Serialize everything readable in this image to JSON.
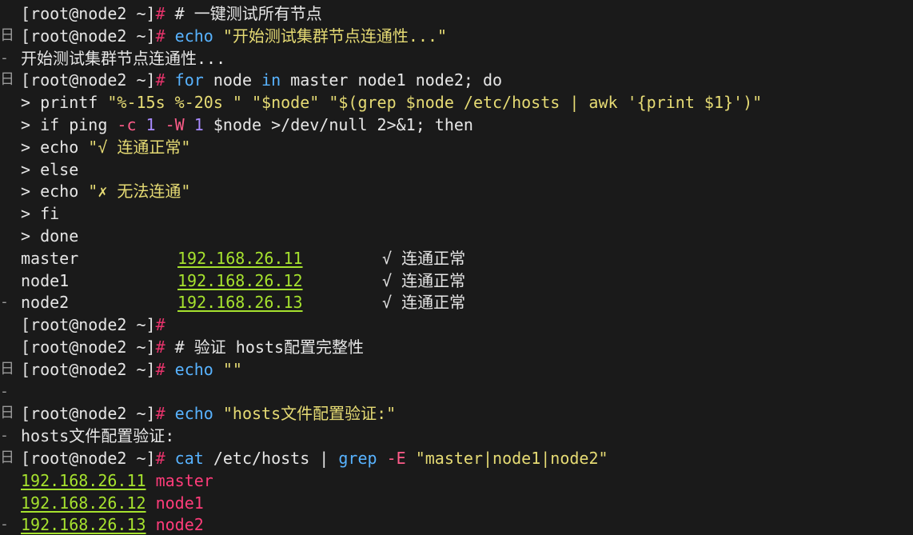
{
  "terminal": {
    "prompt": "[root@node2 ~]",
    "hash": "#",
    "lines": [
      {
        "gutter": "",
        "segments": [
          {
            "t": "prompt"
          },
          {
            "t": "text",
            "v": " # 一键测试所有节点",
            "c": "comment"
          }
        ]
      },
      {
        "gutter": "日",
        "segments": [
          {
            "t": "prompt"
          },
          {
            "t": "text",
            "v": " echo",
            "c": "kw"
          },
          {
            "t": "text",
            "v": " \"开始测试集群节点连通性...\"",
            "c": "str"
          }
        ]
      },
      {
        "gutter": "-",
        "segments": [
          {
            "t": "text",
            "v": "开始测试集群节点连通性...",
            "c": "var"
          }
        ]
      },
      {
        "gutter": "日",
        "segments": [
          {
            "t": "prompt"
          },
          {
            "t": "text",
            "v": " for",
            "c": "kw"
          },
          {
            "t": "text",
            "v": " node ",
            "c": "var"
          },
          {
            "t": "text",
            "v": "in",
            "c": "kw"
          },
          {
            "t": "text",
            "v": " master node1 node2; ",
            "c": "var"
          },
          {
            "t": "text",
            "v": "do",
            "c": "var"
          }
        ]
      },
      {
        "gutter": "",
        "segments": [
          {
            "t": "text",
            "v": "> printf ",
            "c": "var"
          },
          {
            "t": "text",
            "v": "\"%-15s %-20s \"",
            "c": "str"
          },
          {
            "t": "text",
            "v": " \"$node\" \"$(grep $node /etc/hosts | awk '{print $1}')\"",
            "c": "str"
          }
        ]
      },
      {
        "gutter": "",
        "segments": [
          {
            "t": "text",
            "v": "> if ping ",
            "c": "var"
          },
          {
            "t": "text",
            "v": "-c",
            "c": "opt"
          },
          {
            "t": "text",
            "v": " 1 ",
            "c": "num"
          },
          {
            "t": "text",
            "v": "-W",
            "c": "opt"
          },
          {
            "t": "text",
            "v": " 1 ",
            "c": "num"
          },
          {
            "t": "text",
            "v": "$node >/dev/null 2>&1; then",
            "c": "var"
          }
        ]
      },
      {
        "gutter": "",
        "segments": [
          {
            "t": "text",
            "v": "> echo ",
            "c": "var"
          },
          {
            "t": "text",
            "v": "\"√ 连通正常\"",
            "c": "str"
          }
        ]
      },
      {
        "gutter": "",
        "segments": [
          {
            "t": "text",
            "v": "> else",
            "c": "var"
          }
        ]
      },
      {
        "gutter": "",
        "segments": [
          {
            "t": "text",
            "v": "> echo ",
            "c": "var"
          },
          {
            "t": "text",
            "v": "\"✗ 无法连通\"",
            "c": "str"
          }
        ]
      },
      {
        "gutter": "",
        "segments": [
          {
            "t": "text",
            "v": "> fi",
            "c": "var"
          }
        ]
      },
      {
        "gutter": "",
        "segments": [
          {
            "t": "text",
            "v": "> done",
            "c": "var"
          }
        ]
      }
    ],
    "results": [
      {
        "gutter": "",
        "node": "master",
        "ip": "192.168.26.11",
        "status": "√ 连通正常"
      },
      {
        "gutter": "",
        "node": "node1",
        "ip": "192.168.26.12",
        "status": "√ 连通正常"
      },
      {
        "gutter": "-",
        "node": "node2",
        "ip": "192.168.26.13",
        "status": "√ 连通正常"
      }
    ],
    "lines2": [
      {
        "gutter": "",
        "segments": [
          {
            "t": "prompt"
          }
        ]
      },
      {
        "gutter": "",
        "segments": [
          {
            "t": "prompt"
          },
          {
            "t": "text",
            "v": " # 验证 hosts配置完整性",
            "c": "comment"
          }
        ]
      },
      {
        "gutter": "日",
        "segments": [
          {
            "t": "prompt"
          },
          {
            "t": "text",
            "v": " echo",
            "c": "kw"
          },
          {
            "t": "text",
            "v": " \"\"",
            "c": "str"
          }
        ]
      },
      {
        "gutter": "-",
        "segments": []
      },
      {
        "gutter": "日",
        "segments": [
          {
            "t": "prompt"
          },
          {
            "t": "text",
            "v": " echo",
            "c": "kw"
          },
          {
            "t": "text",
            "v": " \"hosts文件配置验证:\"",
            "c": "str"
          }
        ]
      },
      {
        "gutter": "-",
        "segments": [
          {
            "t": "text",
            "v": "hosts文件配置验证:",
            "c": "var"
          }
        ]
      },
      {
        "gutter": "日",
        "segments": [
          {
            "t": "prompt"
          },
          {
            "t": "text",
            "v": " cat",
            "c": "kw"
          },
          {
            "t": "text",
            "v": " /etc/hosts | ",
            "c": "var"
          },
          {
            "t": "text",
            "v": "grep",
            "c": "kw"
          },
          {
            "t": "text",
            "v": " -E",
            "c": "opt"
          },
          {
            "t": "text",
            "v": " \"master|node1|node2\"",
            "c": "str"
          }
        ]
      }
    ],
    "hosts": [
      {
        "gutter": "",
        "ip": "192.168.26.11",
        "name": "master"
      },
      {
        "gutter": "",
        "ip": "192.168.26.12",
        "name": "node1"
      },
      {
        "gutter": "-",
        "ip": "192.168.26.13",
        "name": "node2"
      }
    ]
  }
}
